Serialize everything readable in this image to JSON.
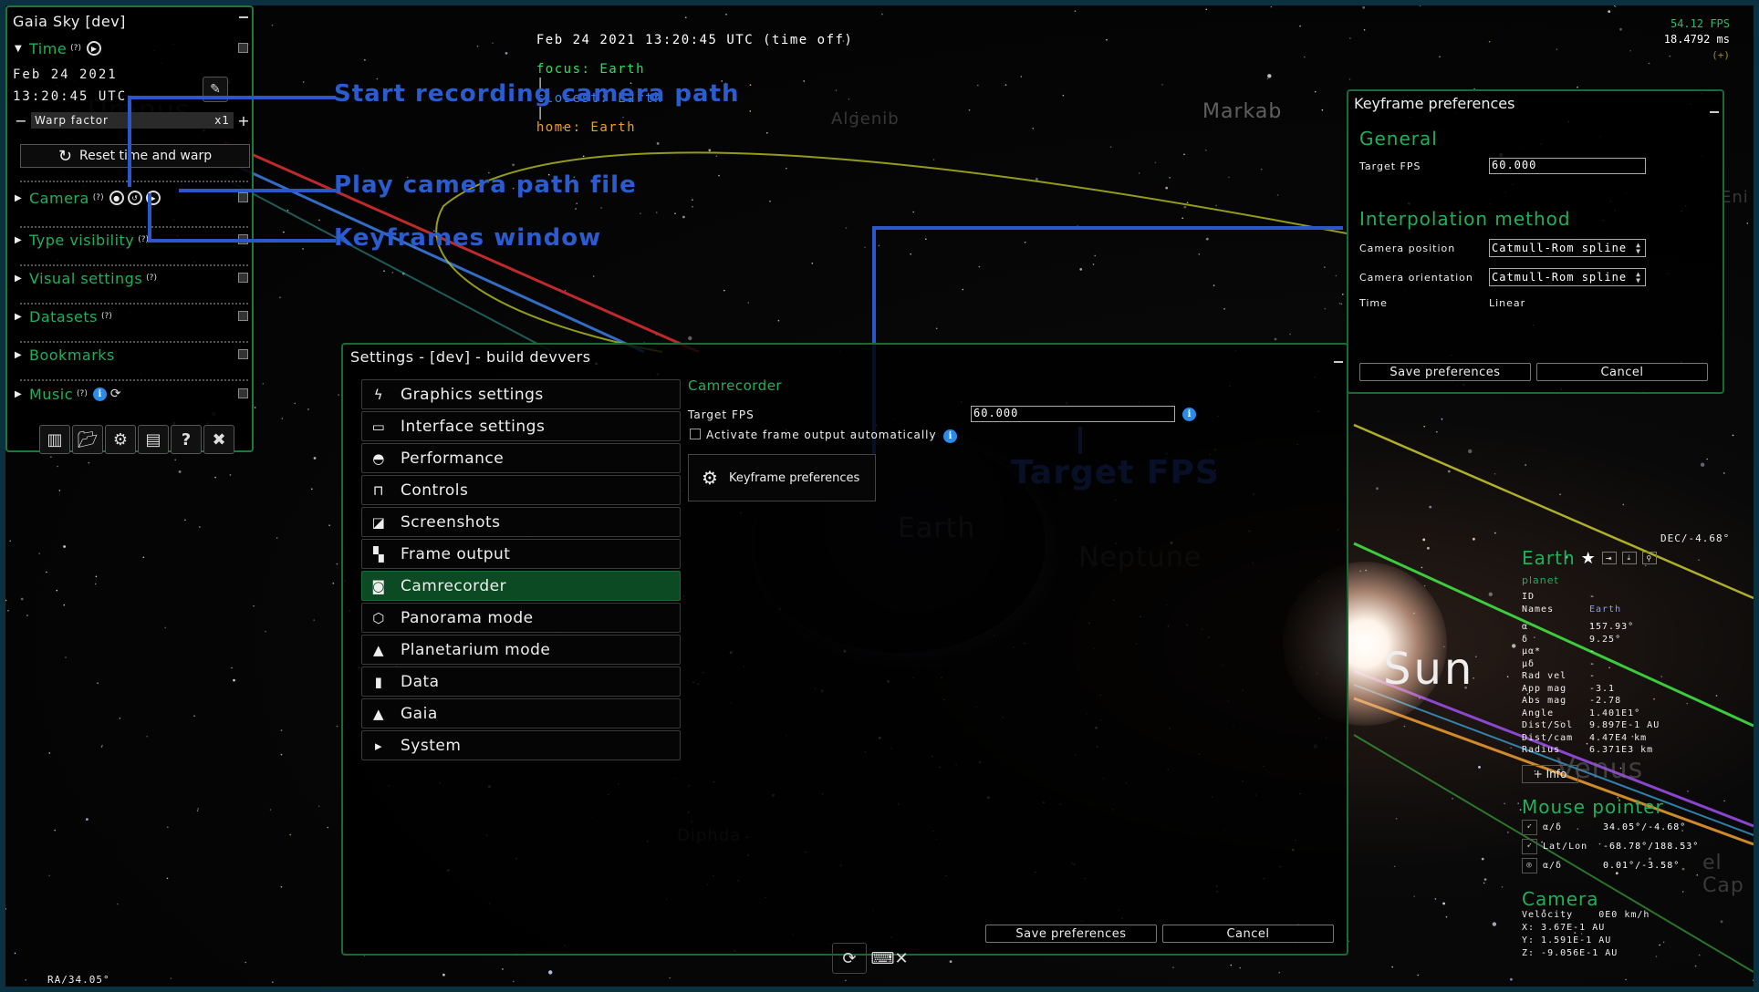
{
  "status_bar": {
    "time": "Feb 24 2021 13:20:45 UTC (time off)",
    "focus": "focus: Earth",
    "closest": "closest: Earth",
    "home": "home: Earth",
    "separator": "|"
  },
  "perf": {
    "fps": "54.12 FPS",
    "frame_time": "18.4792 ms",
    "debug_toggle": "(+)"
  },
  "colors": {
    "accent_green": "#20b058",
    "selected_bg": "#0b4a22",
    "annotation_blue": "#2a5cd0",
    "focus": "#2ee060",
    "closest": "#3c7fe8",
    "home": "#f0a020"
  },
  "control_panel": {
    "title": "Gaia Sky [dev]",
    "time_section": {
      "label": "Time",
      "help": "(?)",
      "date": "Feb 24 2021",
      "clock": "13:20:45 UTC",
      "warp_label": "Warp factor",
      "warp_value": "x1",
      "reset_label": "Reset time and warp"
    },
    "sections": [
      {
        "label": "Camera",
        "help": "(?)"
      },
      {
        "label": "Type visibility",
        "help": "(?)"
      },
      {
        "label": "Visual settings",
        "help": "(?)"
      },
      {
        "label": "Datasets",
        "help": "(?)"
      },
      {
        "label": "Bookmarks",
        "help": ""
      },
      {
        "label": "Music",
        "help": "(?)"
      }
    ],
    "tools": [
      "map-icon",
      "folder-icon",
      "gear-icon",
      "log-icon",
      "help-icon",
      "quit-icon"
    ]
  },
  "annotations": {
    "record": "Start recording camera path",
    "play": "Play camera path file",
    "keyframes": "Keyframes window",
    "target_fps": "Target FPS"
  },
  "background_labels": {
    "uranus": "Uranus",
    "algenib": "Algenib",
    "markab": "Markab",
    "earth": "Earth",
    "neptune": "Neptune",
    "sun": "Sun",
    "venus": "Venus",
    "diphda": "Diphda",
    "cap": "el Cap",
    "enif": "Eni"
  },
  "settings": {
    "title": "Settings - [dev] - build devvers",
    "nav": [
      {
        "label": "Graphics settings",
        "icon": "bolt-icon",
        "glyph": "ϟ"
      },
      {
        "label": "Interface settings",
        "icon": "window-icon",
        "glyph": "▭"
      },
      {
        "label": "Performance",
        "icon": "gauge-icon",
        "glyph": "◓"
      },
      {
        "label": "Controls",
        "icon": "controls-icon",
        "glyph": "⊓"
      },
      {
        "label": "Screenshots",
        "icon": "screenshot-icon",
        "glyph": "◪"
      },
      {
        "label": "Frame output",
        "icon": "frames-icon",
        "glyph": "▚"
      },
      {
        "label": "Camrecorder",
        "icon": "camera-icon",
        "glyph": "◙"
      },
      {
        "label": "Panorama mode",
        "icon": "cube-icon",
        "glyph": "⬡"
      },
      {
        "label": "Planetarium mode",
        "icon": "dome-icon",
        "glyph": "▲"
      },
      {
        "label": "Data",
        "icon": "clipboard-icon",
        "glyph": "▮"
      },
      {
        "label": "Gaia",
        "icon": "gaia-icon",
        "glyph": "▲"
      },
      {
        "label": "System",
        "icon": "terminal-icon",
        "glyph": "▸"
      }
    ],
    "active_index": 6,
    "camrecorder": {
      "heading": "Camrecorder",
      "target_fps_label": "Target FPS",
      "target_fps_value": "60.000",
      "auto_frame_label": "Activate frame output automatically",
      "auto_frame_checked": false,
      "keyframe_button": "Keyframe preferences"
    },
    "save_label": "Save preferences",
    "cancel_label": "Cancel"
  },
  "keyframe_prefs": {
    "title": "Keyframe preferences",
    "general_heading": "General",
    "target_fps_label": "Target FPS",
    "target_fps_value": "60.000",
    "interp_heading": "Interpolation method",
    "cam_pos_label": "Camera position",
    "cam_pos_value": "Catmull-Rom spline",
    "cam_orient_label": "Camera orientation",
    "cam_orient_value": "Catmull-Rom spline",
    "time_label": "Time",
    "time_value": "Linear",
    "save_label": "Save preferences",
    "cancel_label": "Cancel"
  },
  "focus_info": {
    "name": "Earth",
    "type": "planet",
    "rows": [
      {
        "k": "ID",
        "v": "-"
      },
      {
        "k": "Names",
        "v": "Earth"
      },
      {
        "k": "α",
        "v": "157.93°"
      },
      {
        "k": "δ",
        "v": "9.25°"
      },
      {
        "k": "μα*",
        "v": "-"
      },
      {
        "k": "μδ",
        "v": "-"
      },
      {
        "k": "Rad vel",
        "v": "-"
      },
      {
        "k": "App mag",
        "v": "-3.1"
      },
      {
        "k": "Abs mag",
        "v": "-2.78"
      },
      {
        "k": "Angle",
        "v": "1.401E1°"
      },
      {
        "k": "Dist/Sol",
        "v": "9.897E-1 AU"
      },
      {
        "k": "Dist/cam",
        "v": "4.47E4 km"
      },
      {
        "k": "Radius",
        "v": "6.371E3 km"
      }
    ],
    "more_info": "+ Info",
    "mouse_heading": "Mouse pointer",
    "mouse_rows": [
      {
        "k": "α/δ",
        "v": "34.05°/-4.68°"
      },
      {
        "k": "Lat/Lon",
        "v": "-68.78°/188.53°"
      },
      {
        "k": "α/δ",
        "v": "0.01°/-3.58°"
      }
    ],
    "camera_heading": "Camera",
    "camera_rows": [
      "Velocity    0E0 km/h",
      "X: 3.67E-1 AU",
      "Y: 1.591E-1 AU",
      "Z: -9.056E-1 AU"
    ]
  },
  "coords": {
    "ra": "RA/34.05°",
    "dec": "DEC/-4.68°"
  }
}
